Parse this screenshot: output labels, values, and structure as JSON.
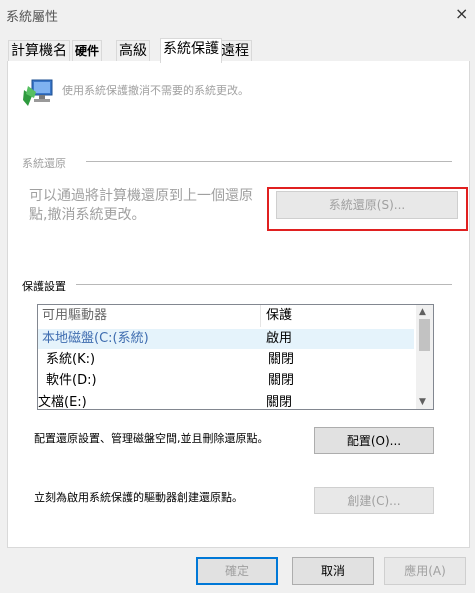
{
  "window": {
    "title": "系統屬性",
    "close_glyph": "×"
  },
  "tabs": [
    {
      "label": "計算機名"
    },
    {
      "label": "硬件"
    },
    {
      "label": "高級"
    },
    {
      "label": "系統保護"
    },
    {
      "label": "遠程"
    }
  ],
  "intro": {
    "text": "使用系統保護撤消不需要的系統更改。",
    "icon": "system-protection-icon"
  },
  "restore_section": {
    "title": "系統還原",
    "text": "可以通過將計算機還原到上一個還原點,撤消系統更改。",
    "button_label": "系統還原(S)..."
  },
  "protection_section": {
    "title": "保護設置",
    "columns": [
      "可用驅動器",
      "保護"
    ],
    "rows": [
      {
        "drive": "本地磁盤(C:(系統)",
        "status": "啟用"
      },
      {
        "drive": "系統(K:)",
        "status": "關閉"
      },
      {
        "drive": "軟件(D:)",
        "status": "關閉"
      },
      {
        "drive": "文檔(E:)",
        "status": "關閉"
      }
    ],
    "configure_text": "配置還原設置、管理磁盤空間,並且刪除還原點。",
    "configure_label": "配置(O)...",
    "create_text": "立刻為啟用系統保護的驅動器創建還原點。",
    "create_label": "創建(C)..."
  },
  "footer": {
    "ok_label": "確定",
    "cancel_label": "取消",
    "apply_label": "應用(A)"
  }
}
